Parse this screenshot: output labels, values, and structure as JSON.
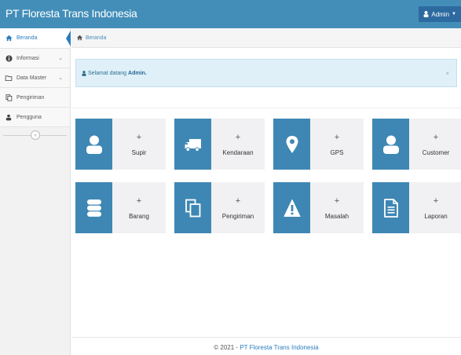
{
  "navbar": {
    "brand": "PT Floresta Trans Indonesia",
    "user": "Admin"
  },
  "sidebar": {
    "items": [
      {
        "label": "Beranda",
        "icon": "home-icon",
        "active": true
      },
      {
        "label": "Informasi",
        "icon": "info-icon",
        "has_children": true
      },
      {
        "label": "Data Master",
        "icon": "folder-icon",
        "has_children": true
      },
      {
        "label": "Pengiriman",
        "icon": "copy-icon"
      },
      {
        "label": "Pengguna",
        "icon": "user-icon"
      }
    ]
  },
  "breadcrumb": {
    "label": "Beranda"
  },
  "alert": {
    "text": "Selamat datang",
    "user": "Admin.",
    "close": "×"
  },
  "tiles": [
    {
      "label": "Supir",
      "icon": "user-icon",
      "plus": "+"
    },
    {
      "label": "Kendaraan",
      "icon": "truck-icon",
      "plus": "+"
    },
    {
      "label": "GPS",
      "icon": "map-marker-icon",
      "plus": "+"
    },
    {
      "label": "Customer",
      "icon": "user-icon",
      "plus": "+"
    },
    {
      "label": "Barang",
      "icon": "database-icon",
      "plus": "+"
    },
    {
      "label": "Pengiriman",
      "icon": "copy-icon",
      "plus": "+"
    },
    {
      "label": "Masalah",
      "icon": "warning-icon",
      "plus": "+"
    },
    {
      "label": "Laporan",
      "icon": "file-text-icon",
      "plus": "+"
    }
  ],
  "footer": {
    "copyright": "© 2021 - ",
    "company": "PT Floresta Trans Indonesia"
  },
  "colors": {
    "navbar": "#438eb9",
    "tile_icon_bg": "#3e87b4",
    "tile_text_bg": "#f1f1f3",
    "alert_bg": "#dff0f8"
  }
}
